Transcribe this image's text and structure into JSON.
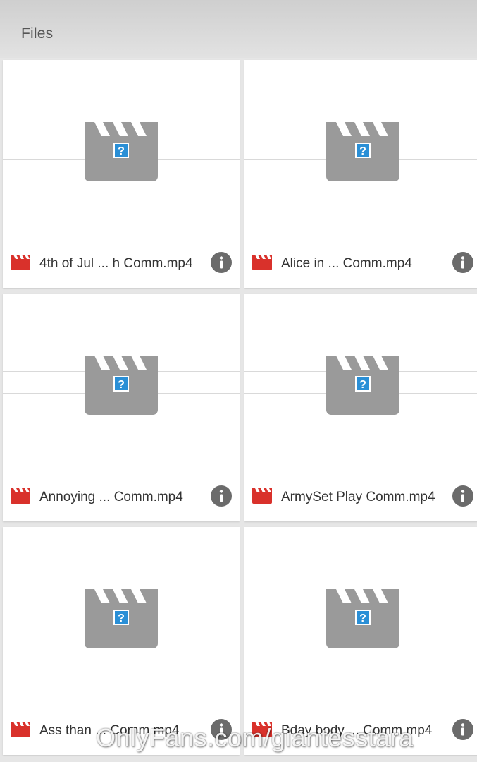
{
  "header": {
    "title": "Files"
  },
  "files": [
    {
      "name": "4th of Jul ... h Comm.mp4",
      "icon": "video-file-icon",
      "info_icon": "info-icon"
    },
    {
      "name": "Alice in ... Comm.mp4",
      "icon": "video-file-icon",
      "info_icon": "info-icon"
    },
    {
      "name": "Annoying ... Comm.mp4",
      "icon": "video-file-icon",
      "info_icon": "info-icon"
    },
    {
      "name": "ArmySet Play Comm.mp4",
      "icon": "video-file-icon",
      "info_icon": "info-icon"
    },
    {
      "name": "Ass than ... Comm.mp4",
      "icon": "video-file-icon",
      "info_icon": "info-icon"
    },
    {
      "name": "Bday body ... Comm.mp4",
      "icon": "video-file-icon",
      "info_icon": "info-icon"
    }
  ],
  "thumbnail": {
    "icon": "video-placeholder-icon",
    "badge": "?"
  },
  "watermark": "OnlyFans.com/giantesstara",
  "colors": {
    "file_icon": "#d9312b",
    "thumbnail": "#9a9a9a",
    "badge": "#2a8fd6",
    "info": "#6b6b6b"
  }
}
